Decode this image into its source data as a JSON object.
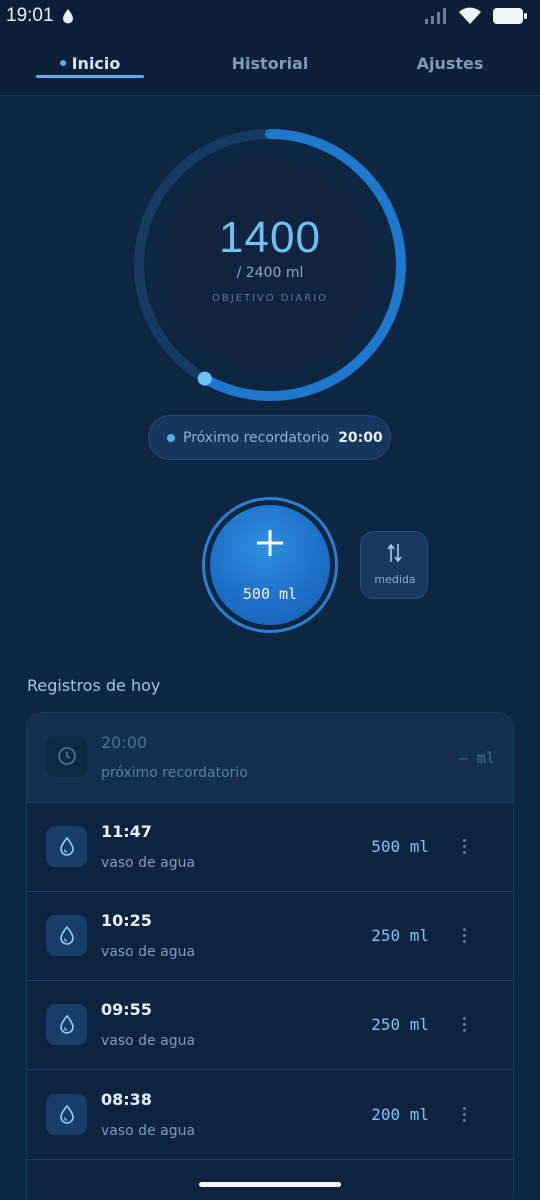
{
  "status_bar": {
    "time": "19:01"
  },
  "nav": {
    "tabs": [
      {
        "label": "Inicio",
        "active": true
      },
      {
        "label": "Historial",
        "active": false
      },
      {
        "label": "Ajustes",
        "active": false
      }
    ]
  },
  "progress": {
    "value": "1400",
    "goal": "/ 2400 ml",
    "caption": "OBJETIVO DIARIO",
    "fraction": 0.583
  },
  "reminder": {
    "label": "Próximo recordatorio",
    "time": "20:00"
  },
  "add_button": {
    "amount": "500 ml"
  },
  "unit_button": {
    "label": "medida"
  },
  "records": {
    "title": "Registros de hoy",
    "pending": {
      "time": "20:00",
      "subtitle": "próximo recordatorio",
      "amount": "— ml"
    },
    "items": [
      {
        "time": "11:47",
        "subtitle": "vaso de agua",
        "amount": "500 ml"
      },
      {
        "time": "10:25",
        "subtitle": "vaso de agua",
        "amount": "250 ml"
      },
      {
        "time": "09:55",
        "subtitle": "vaso de agua",
        "amount": "250 ml"
      },
      {
        "time": "08:38",
        "subtitle": "vaso de agua",
        "amount": "200 ml"
      }
    ]
  },
  "colors": {
    "background": "#0f2642",
    "accent": "#4fb3f0",
    "ring": "#1e78cc"
  }
}
